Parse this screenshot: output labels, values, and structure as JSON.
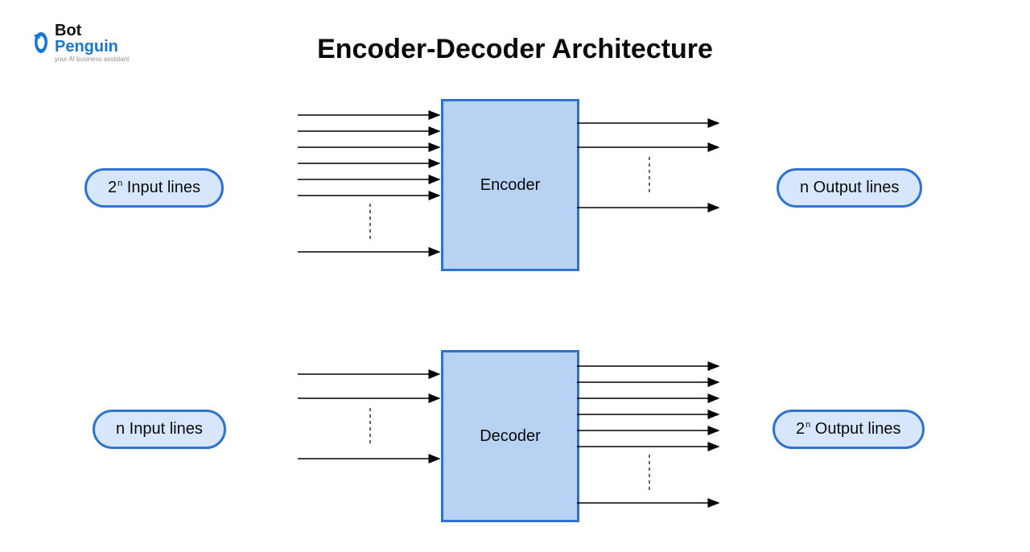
{
  "logo": {
    "top": "Bot",
    "bottom": "Penguin",
    "tagline": "your AI business assistant"
  },
  "title": "Encoder-Decoder Architecture",
  "encoder": {
    "left_pill_prefix": "2",
    "left_pill_sup": "n",
    "left_pill_suffix": " Input lines",
    "box_label": "Encoder",
    "right_pill": "n Output lines"
  },
  "decoder": {
    "left_pill": "n Input lines",
    "box_label": "Decoder",
    "right_pill_prefix": "2",
    "right_pill_sup": "n",
    "right_pill_suffix": " Output lines"
  }
}
